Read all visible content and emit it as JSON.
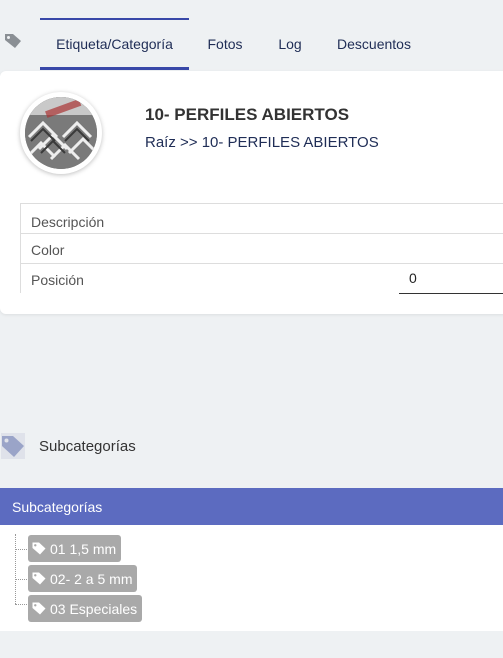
{
  "tabs": [
    {
      "label": "Etiqueta/Categoría",
      "active": true
    },
    {
      "label": "Fotos",
      "active": false
    },
    {
      "label": "Log",
      "active": false
    },
    {
      "label": "Descuentos",
      "active": false
    }
  ],
  "category": {
    "title": "10- PERFILES ABIERTOS",
    "breadcrumb": "Raíz >> 10- PERFILES ABIERTOS",
    "image_icon": "steel-profiles-photo"
  },
  "properties": [
    {
      "label": "Descripción",
      "value": ""
    },
    {
      "label": "Color",
      "value": ""
    },
    {
      "label": "Posición",
      "value": "0"
    }
  ],
  "subcategories_section": {
    "title": "Subcategorías",
    "icon": "tag-icon"
  },
  "subcategories_panel": {
    "header": "Subcategorías",
    "header_color": "#5c6bc0",
    "items": [
      "01 1,5 mm",
      "02- 2 a 5 mm",
      "03 Especiales"
    ]
  },
  "colors": {
    "accent": "#3848a8",
    "chip": "#a9a9a9",
    "background": "#eef1f3"
  }
}
